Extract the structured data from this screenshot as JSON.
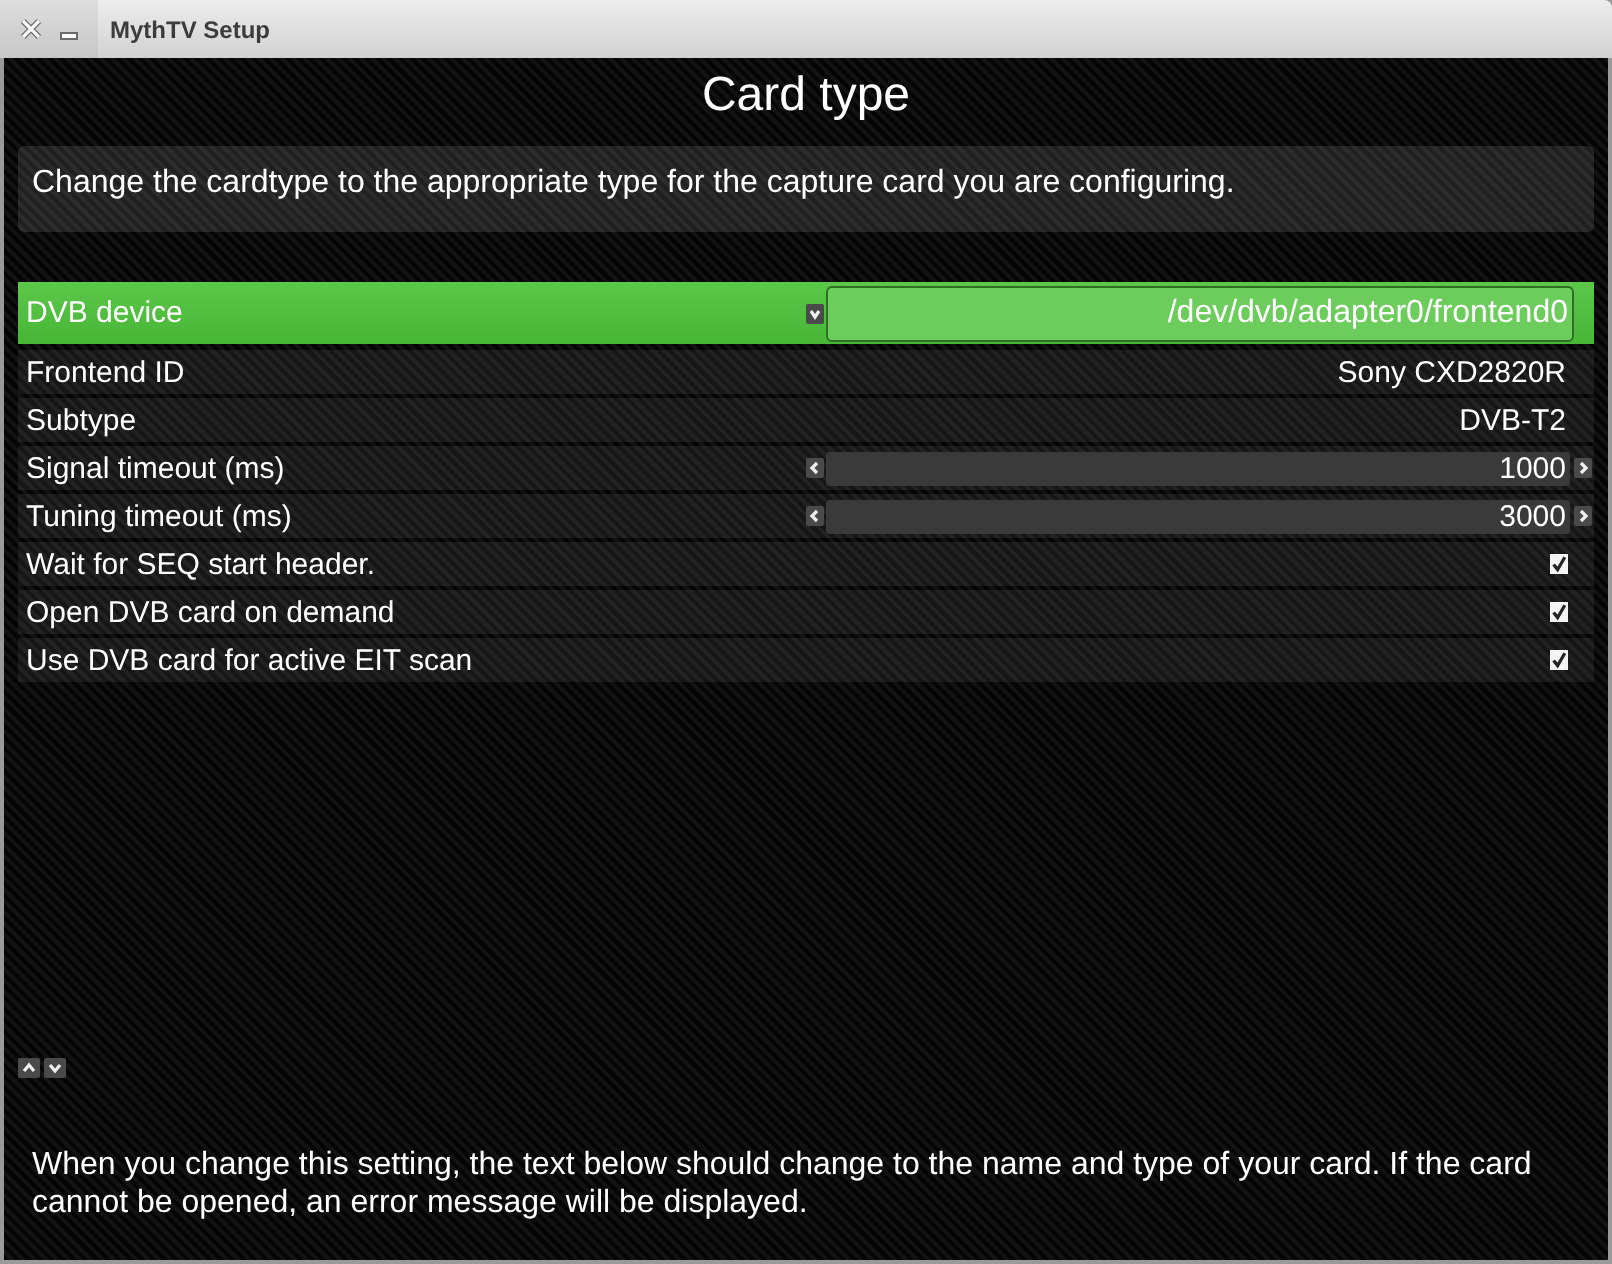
{
  "window": {
    "title": "MythTV Setup"
  },
  "heading": "Card type",
  "description": "Change the cardtype to the appropriate type for the capture card you are configuring.",
  "settings": [
    {
      "kind": "dropdown",
      "label": "DVB device",
      "value": "/dev/dvb/adapter0/frontend0",
      "selected": true
    },
    {
      "kind": "text",
      "label": "Frontend ID",
      "value": "Sony CXD2820R",
      "selected": false
    },
    {
      "kind": "text",
      "label": "Subtype",
      "value": "DVB-T2",
      "selected": false
    },
    {
      "kind": "spinbox",
      "label": "Signal timeout (ms)",
      "value": "1000",
      "selected": false
    },
    {
      "kind": "spinbox",
      "label": "Tuning timeout (ms)",
      "value": "3000",
      "selected": false
    },
    {
      "kind": "checkbox",
      "label": "Wait for SEQ start header.",
      "checked": true,
      "selected": false
    },
    {
      "kind": "checkbox",
      "label": "Open DVB card on demand",
      "checked": true,
      "selected": false
    },
    {
      "kind": "checkbox",
      "label": "Use DVB card for active EIT scan",
      "checked": true,
      "selected": false
    }
  ],
  "help_text": "When you change this setting, the text below should change to the name and type of your card. If the card cannot be opened, an error message will be displayed."
}
